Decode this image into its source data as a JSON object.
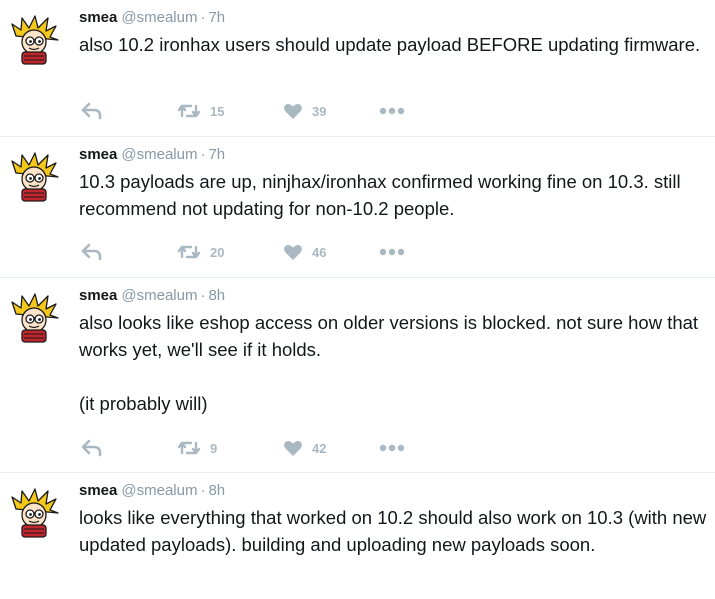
{
  "tweets": [
    {
      "name": "smea",
      "handle": "@smealum",
      "separator": "·",
      "time": "7h",
      "paragraphs": [
        "also 10.2 ironhax users should update payload BEFORE updating firmware."
      ],
      "retweets": "15",
      "likes": "39"
    },
    {
      "name": "smea",
      "handle": "@smealum",
      "separator": "·",
      "time": "7h",
      "paragraphs": [
        "10.3 payloads are up, ninjhax/ironhax confirmed working fine on 10.3. still recommend not updating for non-10.2 people."
      ],
      "retweets": "20",
      "likes": "46"
    },
    {
      "name": "smea",
      "handle": "@smealum",
      "separator": "·",
      "time": "8h",
      "paragraphs": [
        "also looks like eshop access on older versions is blocked. not sure how that works yet, we'll see if it holds.",
        "(it probably will)"
      ],
      "retweets": "9",
      "likes": "42"
    },
    {
      "name": "smea",
      "handle": "@smealum",
      "separator": "·",
      "time": "8h",
      "paragraphs": [
        "looks like everything that worked on 10.2 should also work on 10.3 (with new updated payloads). building and uploading new payloads soon."
      ],
      "retweets": "",
      "likes": ""
    }
  ],
  "icons": {
    "reply": "reply-icon",
    "retweet": "retweet-icon",
    "like": "heart-icon",
    "more": "more-dots-icon"
  },
  "colors": {
    "text": "#14171a",
    "muted": "#8899a6",
    "action": "#aab8c2",
    "divider": "#e6ecf0"
  }
}
